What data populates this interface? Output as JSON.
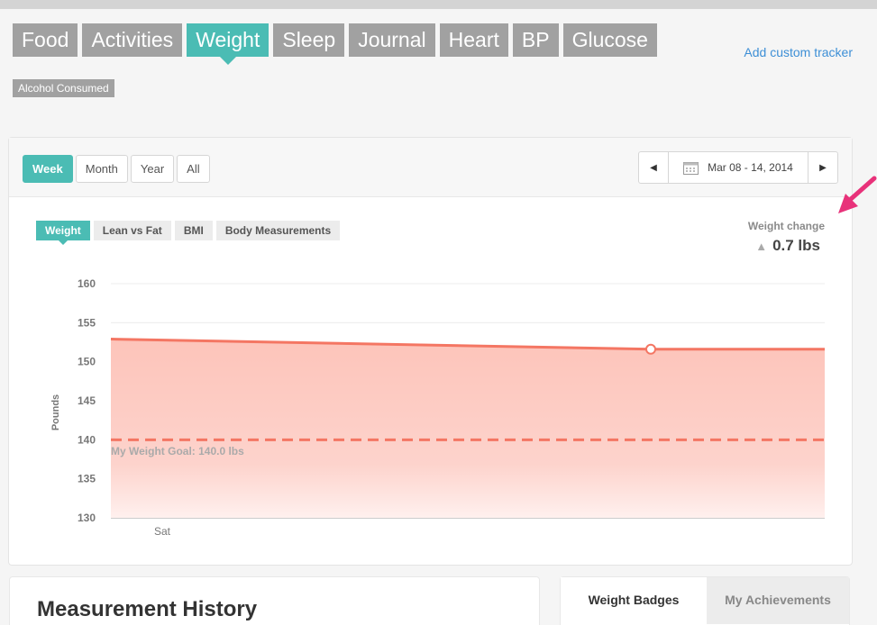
{
  "tabs": [
    "Food",
    "Activities",
    "Weight",
    "Sleep",
    "Journal",
    "Heart",
    "BP",
    "Glucose"
  ],
  "active_tab": "Weight",
  "add_tracker_label": "Add custom tracker",
  "sub_tracker": "Alcohol Consumed",
  "range_buttons": [
    "Week",
    "Month",
    "Year",
    "All"
  ],
  "active_range": "Week",
  "date_range": "Mar 08 - 14, 2014",
  "subtabs": [
    "Weight",
    "Lean vs Fat",
    "BMI",
    "Body Measurements"
  ],
  "weight_change": {
    "label": "Weight change",
    "value": "0.7 lbs",
    "direction": "up"
  },
  "goal_label": "My Weight Goal: 140.0 lbs",
  "colors": {
    "accent": "#4bbcb4",
    "tab_gray": "#a1a1a1",
    "line": "#f47663",
    "fill": "#fdc9c0",
    "callout": "#e8327a",
    "link": "#3d8fd6"
  },
  "chart_data": {
    "type": "area",
    "ylabel": "Pounds",
    "xlabel": "",
    "ylim": [
      130,
      160
    ],
    "yticks": [
      160,
      155,
      150,
      145,
      140,
      135,
      130
    ],
    "xtick_labels": [
      "Sat"
    ],
    "series": [
      {
        "values": [
          152.9,
          151.6,
          151.6
        ],
        "highlight_index": 1
      },
      {
        "name": "My Weight Goal: 140.0 lbs",
        "values": [
          140.0
        ],
        "style": "dashed"
      }
    ],
    "grid": true
  },
  "history_title": "Measurement History",
  "badge_tabs": [
    "Weight Badges",
    "My Achievements"
  ]
}
